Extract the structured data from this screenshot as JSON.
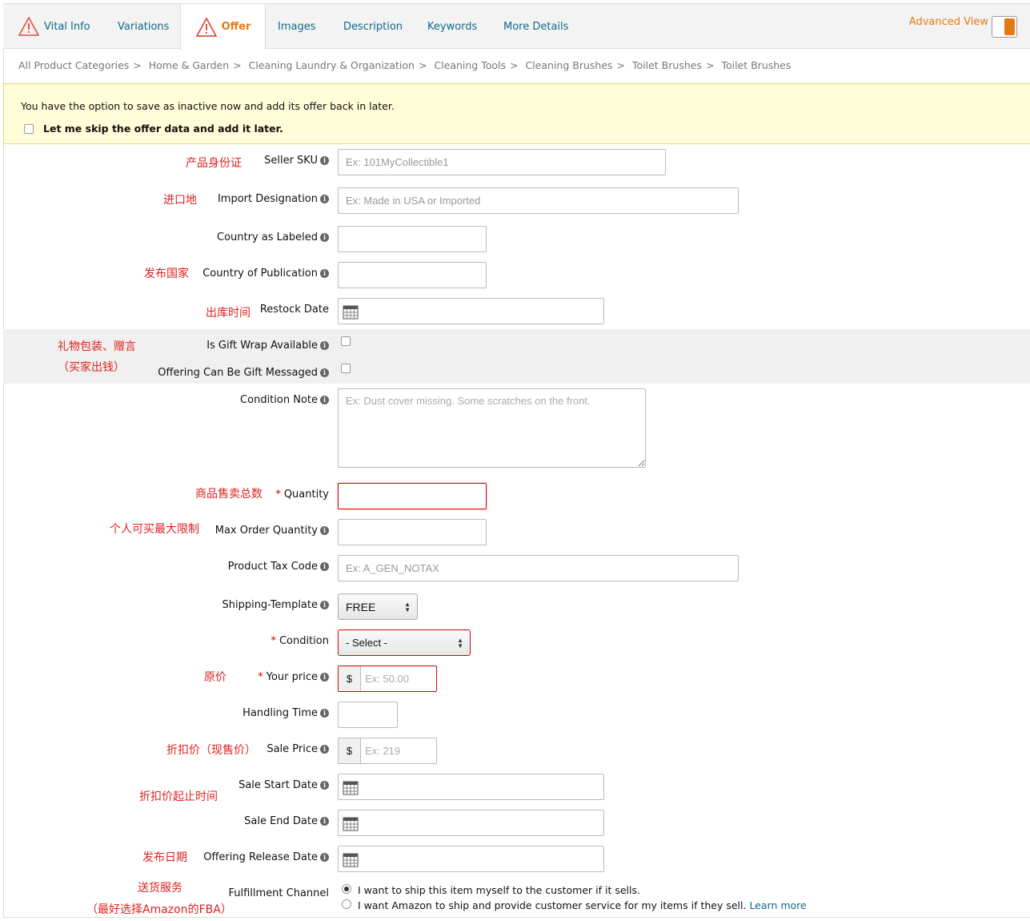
{
  "tabs": [
    {
      "label": "Vital Info",
      "warning": true
    },
    {
      "label": "Variations"
    },
    {
      "label": "Offer",
      "warning": true,
      "active": true
    },
    {
      "label": "Images"
    },
    {
      "label": "Description"
    },
    {
      "label": "Keywords"
    },
    {
      "label": "More Details"
    }
  ],
  "advanced_view": {
    "label": "Advanced View",
    "enabled": true
  },
  "breadcrumb": [
    "All Product Categories",
    "Home & Garden",
    "Cleaning Laundry & Organization",
    "Cleaning Tools",
    "Cleaning Brushes",
    "Toilet Brushes",
    "Toilet Brushes"
  ],
  "notice": {
    "message": "You have the option to save as inactive now and add its offer back in later.",
    "skip_label": "Let me skip the offer data and add it later."
  },
  "annotations": {
    "sku": "产品身份证",
    "import": "进口地",
    "publication": "发布国家",
    "restock": "出库时间",
    "gift_line1": "礼物包装、赠言",
    "gift_line2": "（买家出钱）",
    "quantity": "商品售卖总数",
    "max_order": "个人可买最大限制",
    "price": "原价",
    "sale_price": "折扣价（现售价）",
    "sale_dates": "折扣价起止时间",
    "release": "发布日期",
    "fulfillment_line1": "送货服务",
    "fulfillment_line2": "（最好选择Amazon的FBA）"
  },
  "fields": {
    "seller_sku": {
      "label": "Seller SKU",
      "placeholder": "Ex: 101MyCollectible1"
    },
    "import_designation": {
      "label": "Import Designation",
      "placeholder": "Ex: Made in USA or Imported"
    },
    "country_labeled": {
      "label": "Country as Labeled"
    },
    "country_publication": {
      "label": "Country of Publication"
    },
    "restock_date": {
      "label": "Restock Date"
    },
    "gift_wrap": {
      "label": "Is Gift Wrap Available"
    },
    "gift_message": {
      "label": "Offering Can Be Gift Messaged"
    },
    "condition_note": {
      "label": "Condition Note",
      "placeholder": "Ex: Dust cover missing. Some scratches on the front."
    },
    "quantity": {
      "label": "Quantity",
      "required": true
    },
    "max_order_quantity": {
      "label": "Max Order Quantity"
    },
    "product_tax_code": {
      "label": "Product Tax Code",
      "placeholder": "Ex: A_GEN_NOTAX"
    },
    "shipping_template": {
      "label": "Shipping-Template",
      "value": "FREE"
    },
    "condition": {
      "label": "Condition",
      "required": true,
      "value": "- Select -"
    },
    "your_price": {
      "label": "Your price",
      "required": true,
      "currency": "$",
      "placeholder": "Ex: 50.00"
    },
    "handling_time": {
      "label": "Handling Time"
    },
    "sale_price": {
      "label": "Sale Price",
      "currency": "$",
      "placeholder": "Ex: 219"
    },
    "sale_start_date": {
      "label": "Sale Start Date"
    },
    "sale_end_date": {
      "label": "Sale End Date"
    },
    "offering_release_date": {
      "label": "Offering Release Date"
    },
    "fulfillment_channel": {
      "label": "Fulfillment Channel",
      "options": [
        {
          "label": "I want to ship this item myself to the customer if it sells.",
          "selected": true
        },
        {
          "label": "I want Amazon to ship and provide customer service for my items if they sell.",
          "link": "Learn more",
          "selected": false
        }
      ]
    }
  },
  "colors": {
    "accent": "#e47911",
    "link": "#0f6a8a",
    "annotation": "#e02020",
    "error": "#d00000",
    "notice_bg": "#fffcd8"
  }
}
